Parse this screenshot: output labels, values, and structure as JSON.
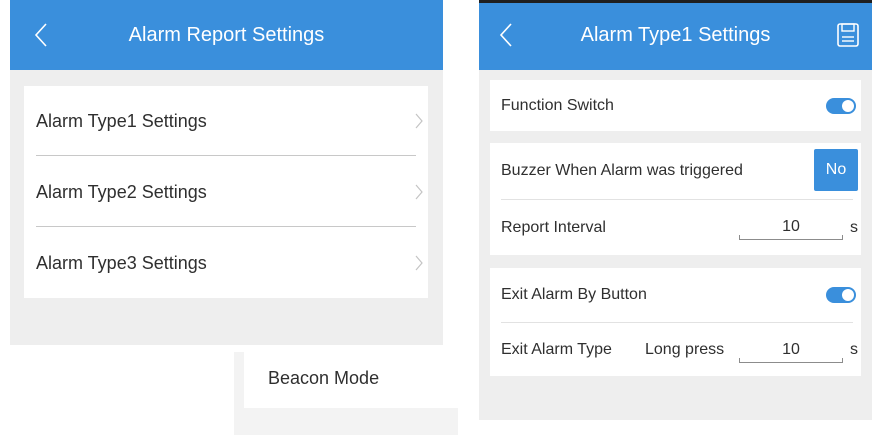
{
  "left": {
    "title": "Alarm Report Settings",
    "items": [
      {
        "label": "Alarm Type1 Settings"
      },
      {
        "label": "Alarm Type2 Settings"
      },
      {
        "label": "Alarm Type3 Settings"
      }
    ]
  },
  "beacon": {
    "label": "Beacon Mode"
  },
  "right": {
    "title": "Alarm Type1 Settings",
    "function_switch": {
      "label": "Function Switch",
      "on": true
    },
    "buzzer": {
      "label": "Buzzer When Alarm was triggered",
      "button": "No"
    },
    "report_interval": {
      "label": "Report Interval",
      "value": "10",
      "unit": "s"
    },
    "exit_by_button": {
      "label": "Exit Alarm By Button",
      "on": true
    },
    "exit_type": {
      "label": "Exit Alarm Type",
      "mode": "Long press",
      "value": "10",
      "unit": "s"
    }
  },
  "colors": {
    "accent": "#3a8fdc",
    "background": "#eeeeee"
  },
  "icons": [
    "back-arrow-icon",
    "chevron-right-icon",
    "save-icon",
    "toggle-switch"
  ]
}
